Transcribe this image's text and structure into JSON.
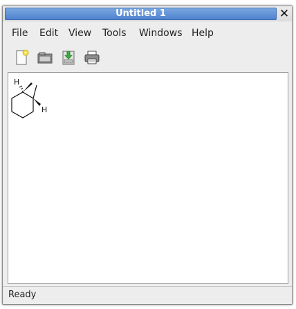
{
  "window": {
    "title": "Untitled 1",
    "close_glyph": "✕"
  },
  "menu": {
    "items": [
      {
        "label": "File"
      },
      {
        "label": "Edit"
      },
      {
        "label": "View"
      },
      {
        "label": "Tools"
      },
      {
        "label": "Windows"
      },
      {
        "label": "Help"
      }
    ]
  },
  "toolbar": {
    "buttons": [
      {
        "icon": "new-document-icon"
      },
      {
        "icon": "open-folder-icon"
      },
      {
        "icon": "save-download-icon"
      },
      {
        "icon": "print-icon"
      }
    ]
  },
  "canvas": {
    "molecule": {
      "label_h_top": "H",
      "label_h_right": "H"
    }
  },
  "status": {
    "text": "Ready"
  },
  "colors": {
    "title_bar": "#5b8dd6",
    "window_bg": "#ededed",
    "canvas_bg": "#ffffff"
  }
}
